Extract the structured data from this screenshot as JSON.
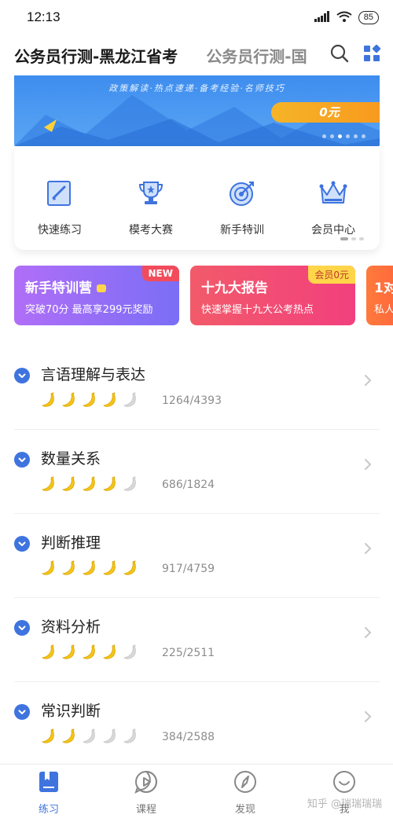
{
  "status_bar": {
    "time": "12:13",
    "battery": "85"
  },
  "header": {
    "active_tab": "公务员行测-黑龙江省考",
    "next_tab": "公务员行测-国"
  },
  "banner": {
    "tagline": "政策解读·热点速递·备考经验·名师技巧",
    "price": "0元"
  },
  "quick_actions": [
    {
      "label": "快速练习",
      "icon": "practice-book-icon"
    },
    {
      "label": "模考大赛",
      "icon": "trophy-icon"
    },
    {
      "label": "新手特训",
      "icon": "target-icon"
    },
    {
      "label": "会员中心",
      "icon": "crown-icon"
    }
  ],
  "promos": [
    {
      "title": "新手特训营",
      "subtitle": "突破70分 最高享299元奖励",
      "badge": "NEW"
    },
    {
      "title": "十九大报告",
      "subtitle": "快速掌握十九大公考热点",
      "badge": "会员0元"
    },
    {
      "title": "1对",
      "subtitle": "私人"
    }
  ],
  "subjects": [
    {
      "name": "言语理解与表达",
      "count": "1264/4393",
      "rating": 4,
      "max_rating": 5
    },
    {
      "name": "数量关系",
      "count": "686/1824",
      "rating": 4,
      "max_rating": 5
    },
    {
      "name": "判断推理",
      "count": "917/4759",
      "rating": 5,
      "max_rating": 5
    },
    {
      "name": "资料分析",
      "count": "225/2511",
      "rating": 4,
      "max_rating": 5
    },
    {
      "name": "常识判断",
      "count": "384/2588",
      "rating": 2,
      "max_rating": 5
    }
  ],
  "bottom_nav": [
    {
      "label": "练习",
      "icon": "practice-icon",
      "active": true
    },
    {
      "label": "课程",
      "icon": "course-play-icon",
      "active": false
    },
    {
      "label": "发现",
      "icon": "compass-icon",
      "active": false
    },
    {
      "label": "我",
      "icon": "profile-smile-icon",
      "active": false
    }
  ],
  "watermark": "知乎 @瑞瑞瑞瑞",
  "colors": {
    "accent": "#3f74df",
    "banana_on": "#f5c518",
    "banana_off": "#d9d9d9"
  }
}
